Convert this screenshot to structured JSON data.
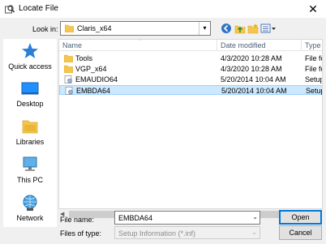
{
  "window": {
    "title": "Locate File",
    "close_glyph": "✕"
  },
  "toolbar": {
    "lookin_label": "Look in:",
    "lookin_value": "Claris_x64",
    "icons": [
      "back-icon",
      "up-folder-icon",
      "new-folder-icon",
      "view-menu-icon"
    ]
  },
  "places": [
    {
      "label": "Quick access",
      "icon": "star-icon"
    },
    {
      "label": "Desktop",
      "icon": "desktop-icon"
    },
    {
      "label": "Libraries",
      "icon": "libraries-icon"
    },
    {
      "label": "This PC",
      "icon": "computer-icon"
    },
    {
      "label": "Network",
      "icon": "network-icon"
    }
  ],
  "columns": {
    "name": "Name",
    "date": "Date modified",
    "type": "Type"
  },
  "files": [
    {
      "name": "Tools",
      "date": "4/3/2020 10:28 AM",
      "type": "File fo",
      "icon": "folder-icon"
    },
    {
      "name": "VGP_x64",
      "date": "4/3/2020 10:28 AM",
      "type": "File fo",
      "icon": "folder-icon"
    },
    {
      "name": "EMAUDIO64",
      "date": "5/20/2014 10:04 AM",
      "type": "Setup",
      "icon": "setup-info-icon"
    },
    {
      "name": "EMBDA64",
      "date": "5/20/2014 10:04 AM",
      "type": "Setup",
      "icon": "setup-info-icon",
      "selected": true
    }
  ],
  "form": {
    "filename_label": "File name:",
    "filename_value": "EMBDA64",
    "filetype_label": "Files of type:",
    "filetype_value": "Setup Information (*.inf)"
  },
  "buttons": {
    "open": "Open",
    "cancel": "Cancel"
  },
  "colors": {
    "selection": "#cce8ff",
    "accent": "#0078d7",
    "folder": "#f5c64e"
  }
}
